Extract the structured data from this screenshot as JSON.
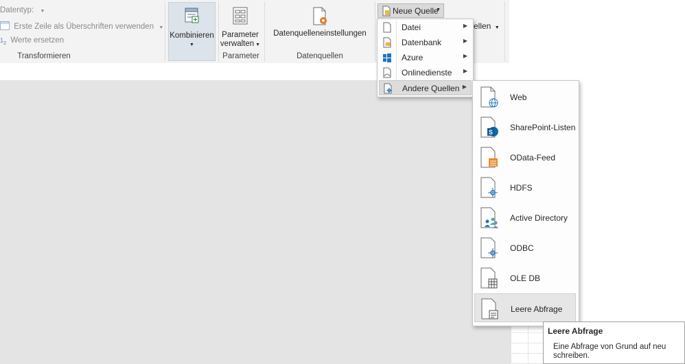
{
  "transformieren": {
    "datentyp_label": "Datentyp:",
    "first_row_label": "Erste Zeile als Überschriften verwenden",
    "replace_values_label": "Werte ersetzen",
    "group_label": "Transformieren"
  },
  "kombinieren": {
    "button_label": "Kombinieren"
  },
  "parameter": {
    "button_line1": "Parameter",
    "button_line2": "verwalten",
    "group_label": "Parameter"
  },
  "datenquellen": {
    "button_label": "Datenquelleneinstellungen",
    "group_label": "Datenquellen"
  },
  "neue_quelle": {
    "button_label": "Neue Quelle",
    "partial_label": "ellen"
  },
  "menu": {
    "items": [
      {
        "label": "Datei",
        "icon": "file-icon"
      },
      {
        "label": "Datenbank",
        "icon": "database-icon"
      },
      {
        "label": "Azure",
        "icon": "azure-icon"
      },
      {
        "label": "Onlinedienste",
        "icon": "online-services-icon"
      },
      {
        "label": "Andere Quellen",
        "icon": "other-sources-icon"
      }
    ]
  },
  "submenu": {
    "items": [
      {
        "label": "Web",
        "icon": "web-icon"
      },
      {
        "label": "SharePoint-Listen",
        "icon": "sharepoint-icon"
      },
      {
        "label": "OData-Feed",
        "icon": "odata-icon"
      },
      {
        "label": "HDFS",
        "icon": "hdfs-icon"
      },
      {
        "label": "Active Directory",
        "icon": "active-directory-icon"
      },
      {
        "label": "ODBC",
        "icon": "odbc-icon"
      },
      {
        "label": "OLE DB",
        "icon": "oledb-icon"
      },
      {
        "label": "Leere Abfrage",
        "icon": "blank-query-icon"
      }
    ]
  },
  "tooltip": {
    "title": "Leere Abfrage",
    "line1": "Eine Abfrage von Grund auf neu",
    "line2": "schreiben."
  },
  "colors": {
    "accent": "#f0b545",
    "selected_bg": "#dcdcdc",
    "workspace": "#e4e4e4"
  }
}
